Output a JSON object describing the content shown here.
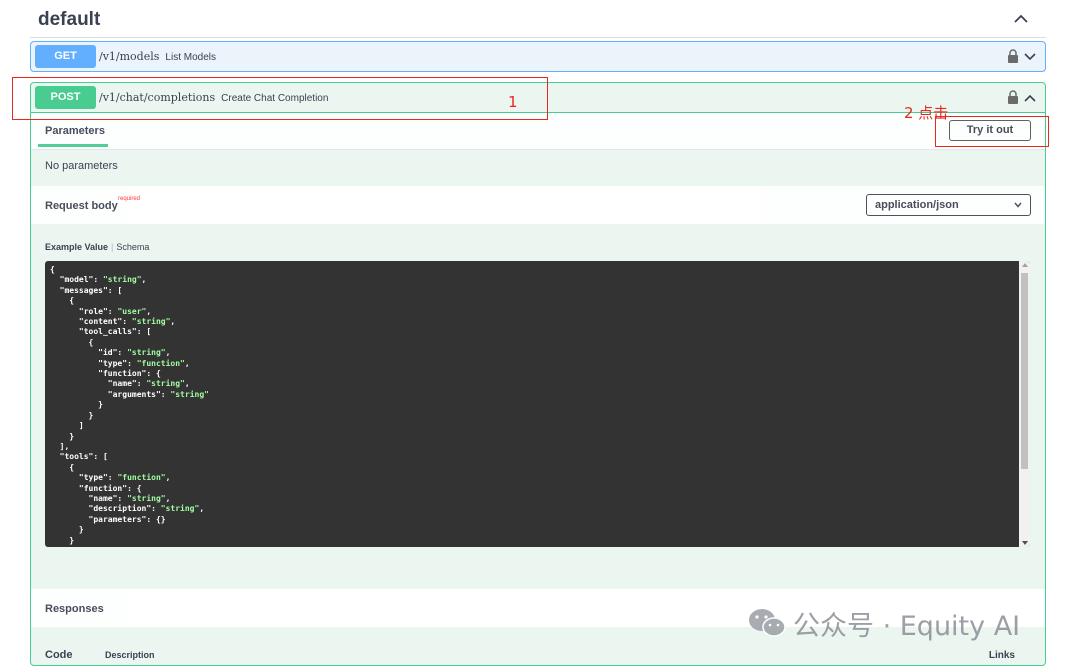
{
  "section": {
    "title": "default"
  },
  "ops": [
    {
      "method": "GET",
      "path": "/v1/models",
      "summary": "List Models"
    },
    {
      "method": "POST",
      "path": "/v1/chat/completions",
      "summary": "Create Chat Completion"
    }
  ],
  "post_panel": {
    "parameters_tab": "Parameters",
    "try_button": "Try it out",
    "no_params": "No parameters",
    "request_body_label": "Request body",
    "required_label": "required",
    "content_type": "application/json",
    "example_tab": "Example Value",
    "schema_tab": "Schema",
    "responses_label": "Responses",
    "col_code": "Code",
    "col_description": "Description",
    "col_links": "Links"
  },
  "annotations": {
    "step1": "1",
    "step2": "2 点击"
  },
  "watermark": "公众号 · Equity AI",
  "colors": {
    "get": "#61affe",
    "post": "#49cc90",
    "annotation": "#e8281e"
  }
}
